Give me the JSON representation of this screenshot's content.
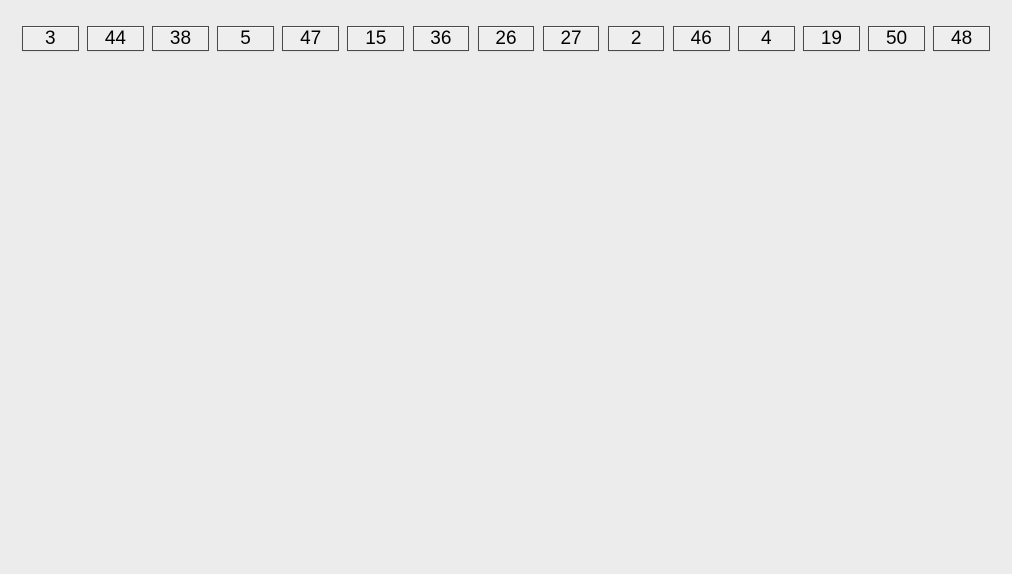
{
  "row": {
    "items": [
      {
        "label": "3"
      },
      {
        "label": "44"
      },
      {
        "label": "38"
      },
      {
        "label": "5"
      },
      {
        "label": "47"
      },
      {
        "label": "15"
      },
      {
        "label": "36"
      },
      {
        "label": "26"
      },
      {
        "label": "27"
      },
      {
        "label": "2"
      },
      {
        "label": "46"
      },
      {
        "label": "4"
      },
      {
        "label": "19"
      },
      {
        "label": "50"
      },
      {
        "label": "48"
      }
    ]
  }
}
